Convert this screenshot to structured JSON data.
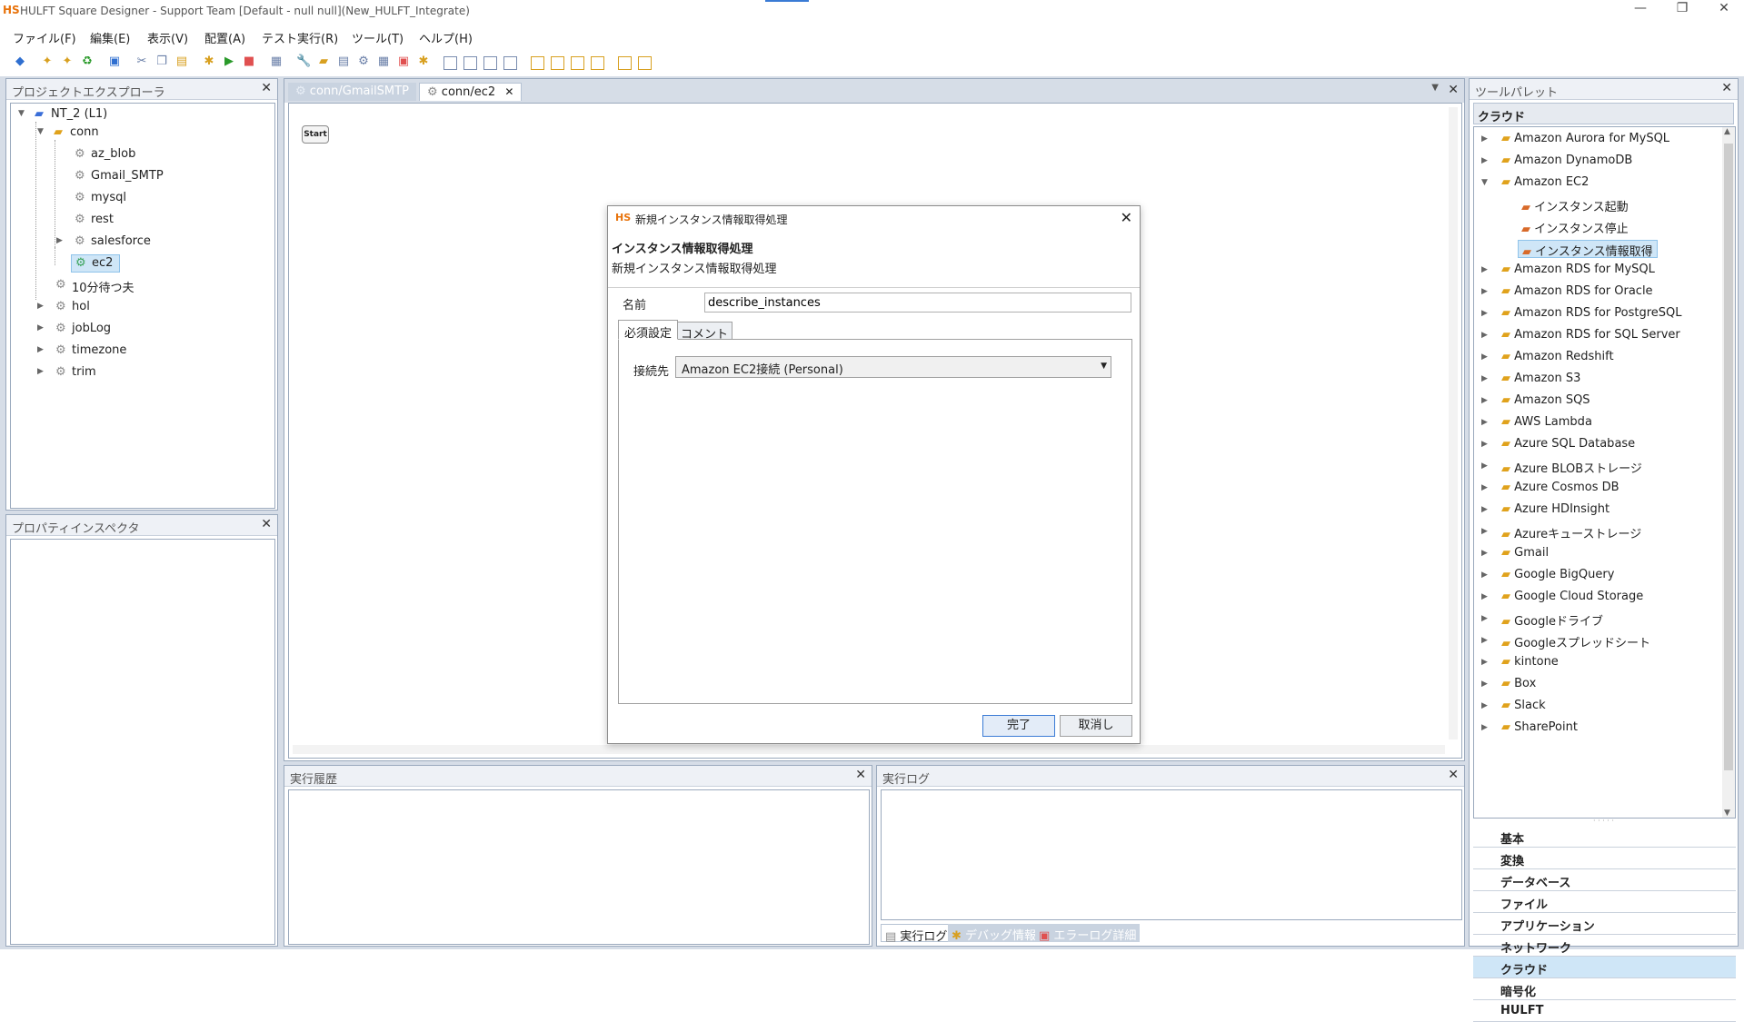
{
  "window": {
    "logo": "HS",
    "title": "HULFT Square Designer - Support Team [Default - null null](New_HULFT_Integrate)",
    "minimize": "—",
    "restore": "❐",
    "close": "✕"
  },
  "menu": [
    "ファイル(F)",
    "編集(E)",
    "表示(V)",
    "配置(A)",
    "テスト実行(R)",
    "ツール(T)",
    "ヘルプ(H)"
  ],
  "project_explorer": {
    "title": "プロジェクトエクスプローラ",
    "root": "NT_2 (L1)",
    "folder": "conn",
    "folder_children": [
      "az_blob",
      "Gmail_SMTP",
      "mysql",
      "rest",
      "salesforce",
      "ec2"
    ],
    "siblings": [
      "10分待つ夫",
      "hol",
      "jobLog",
      "timezone",
      "trim"
    ]
  },
  "property_inspector": {
    "title": "プロパティインスペクタ"
  },
  "editor": {
    "tabs": [
      "conn/GmailSMTP",
      "conn/ec2"
    ],
    "start_label": "Start"
  },
  "dialog": {
    "logo": "HS",
    "title": "新規インスタンス情報取得処理",
    "heading": "インスタンス情報取得処理",
    "subheading": "新規インスタンス情報取得処理",
    "name_label": "名前",
    "name_value": "describe_instances",
    "tabs": [
      "必須設定",
      "コメント"
    ],
    "connection_label": "接続先",
    "connection_value": "Amazon EC2接続 (Personal)",
    "ok": "完了",
    "cancel": "取消し"
  },
  "exec_history": {
    "title": "実行履歴"
  },
  "exec_log": {
    "title": "実行ログ",
    "tabs": [
      "実行ログ",
      "デバッグ情報",
      "エラーログ詳細"
    ]
  },
  "tool_palette": {
    "title": "ツールパレット",
    "section": "クラウド",
    "items_before": [
      "Amazon Aurora for MySQL",
      "Amazon DynamoDB",
      "Amazon EC2"
    ],
    "ec2_children": [
      "インスタンス起動",
      "インスタンス停止",
      "インスタンス情報取得"
    ],
    "items_after": [
      "Amazon RDS for MySQL",
      "Amazon RDS for Oracle",
      "Amazon RDS for PostgreSQL",
      "Amazon RDS for SQL Server",
      "Amazon Redshift",
      "Amazon S3",
      "Amazon SQS",
      "AWS Lambda",
      "Azure SQL Database",
      "Azure BLOBストレージ",
      "Azure Cosmos DB",
      "Azure HDInsight",
      "Azureキューストレージ",
      "Gmail",
      "Google BigQuery",
      "Google Cloud Storage",
      "Googleドライブ",
      "Googleスプレッドシート",
      "kintone",
      "Box",
      "Slack",
      "SharePoint"
    ],
    "categories": [
      "基本",
      "変換",
      "データベース",
      "ファイル",
      "アプリケーション",
      "ネットワーク",
      "クラウド",
      "暗号化",
      "HULFT"
    ],
    "selected_category": "クラウド"
  },
  "colors": {
    "accent": "#3a7bd5",
    "selection": "#cfe6f7",
    "frame": "#d6dde7",
    "logo": "#e8730c"
  }
}
